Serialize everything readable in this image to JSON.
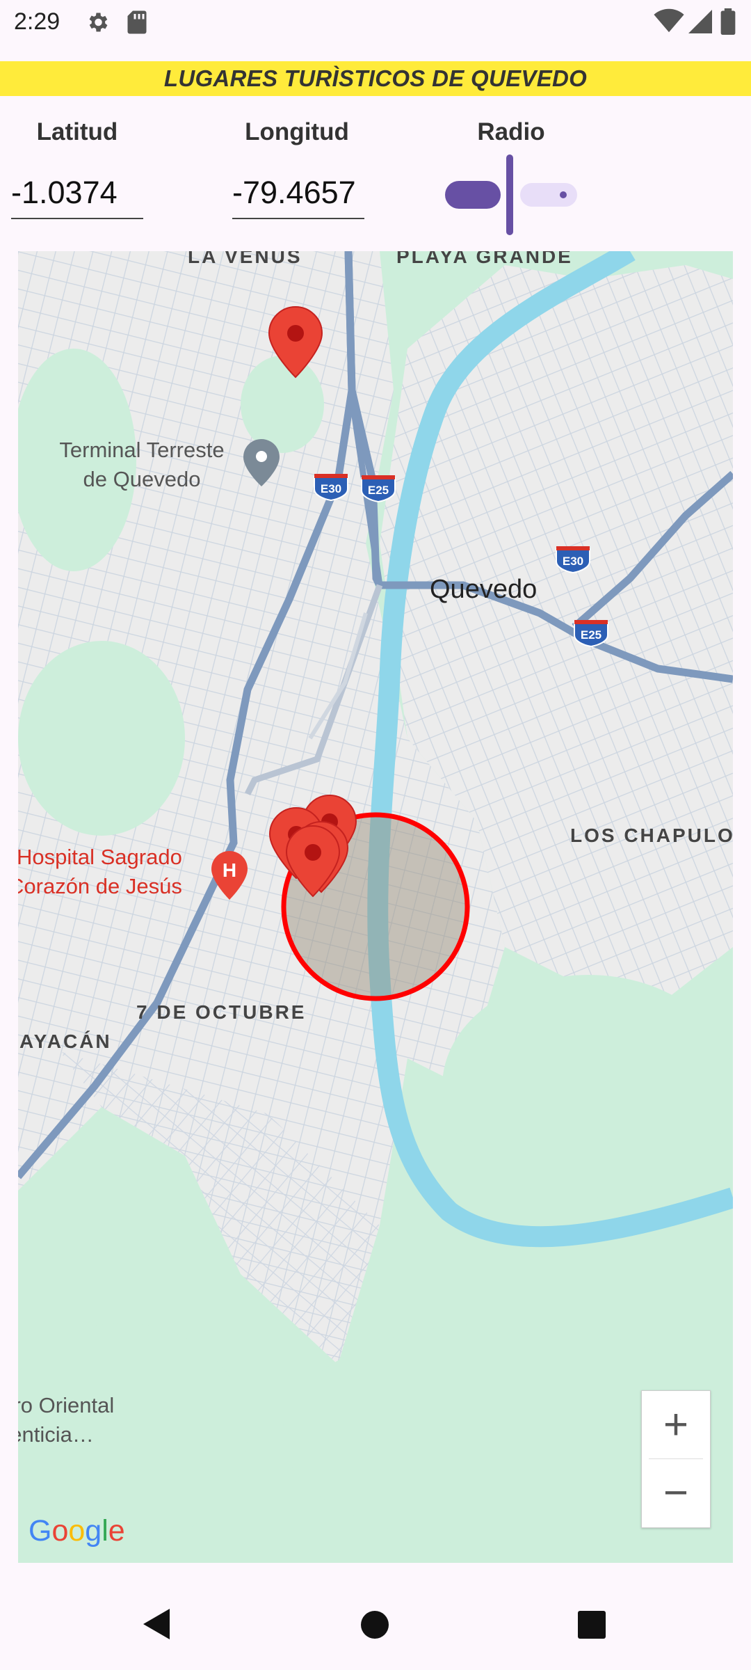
{
  "status_bar": {
    "time": "2:29"
  },
  "header": {
    "title": "LUGARES TURÌSTICOS DE QUEVEDO"
  },
  "form": {
    "lat_label": "Latitud",
    "lat_value": "-1.0374",
    "lon_label": "Longitud",
    "lon_value": "-79.4657",
    "radius_label": "Radio"
  },
  "map": {
    "labels": {
      "la_venus": "LA VENUS",
      "playa_grande": "PLAYA GRANDE",
      "terminal_line1": "Terminal Terreste",
      "terminal_line2": "de Quevedo",
      "quevedo": "Quevedo",
      "los_chapulo": "LOS CHAPULO",
      "hospital_line1": "Hospital Sagrado",
      "hospital_line2": "Corazón de Jesús",
      "siete_octubre": "7 DE OCTUBRE",
      "guayacan": "GUAYACÁN",
      "oriental_line1": "Centro Oriental",
      "oriental_line2": "Alimenticia…"
    },
    "shields": {
      "e30": "E30",
      "e25": "E25"
    },
    "hospital_icon": "H",
    "zoom_in": "+",
    "zoom_out": "−",
    "logo": "Google",
    "colors": {
      "marker": "#ea4335",
      "radius_circle": "#ff0000",
      "river": "#8fd6ea",
      "road": "#7e99bd"
    }
  }
}
